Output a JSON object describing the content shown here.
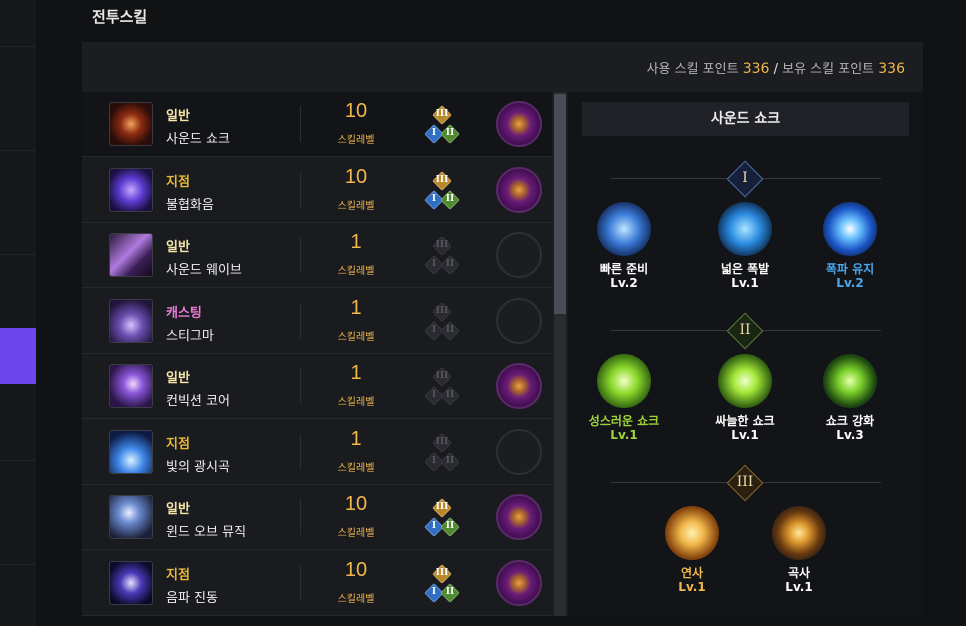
{
  "page": {
    "title": "전투스킬"
  },
  "points": {
    "used_label": "사용 스킬 포인트",
    "used_value": "336",
    "separator": "/",
    "owned_label": "보유 스킬 포인트",
    "owned_value": "336"
  },
  "skills": [
    {
      "type": "일반",
      "type_color": "#f5e6a8",
      "name": "사운드 쇼크",
      "level": "10",
      "level_label": "스킬레벨",
      "tripod_active": true,
      "rune": "purple"
    },
    {
      "type": "지점",
      "type_color": "#e9b931",
      "name": "불협화음",
      "level": "10",
      "level_label": "스킬레벨",
      "tripod_active": true,
      "rune": "purple"
    },
    {
      "type": "일반",
      "type_color": "#f5e6a8",
      "name": "사운드 웨이브",
      "level": "1",
      "level_label": "스킬레벨",
      "tripod_active": false,
      "rune": "empty"
    },
    {
      "type": "캐스팅",
      "type_color": "#e97bd7",
      "name": "스티그마",
      "level": "1",
      "level_label": "스킬레벨",
      "tripod_active": false,
      "rune": "empty"
    },
    {
      "type": "일반",
      "type_color": "#f5e6a8",
      "name": "컨빅션 코어",
      "level": "1",
      "level_label": "스킬레벨",
      "tripod_active": false,
      "rune": "purple"
    },
    {
      "type": "지점",
      "type_color": "#e9b931",
      "name": "빛의 광시곡",
      "level": "1",
      "level_label": "스킬레벨",
      "tripod_active": false,
      "rune": "empty"
    },
    {
      "type": "일반",
      "type_color": "#f5e6a8",
      "name": "윈드 오브 뮤직",
      "level": "10",
      "level_label": "스킬레벨",
      "tripod_active": true,
      "rune": "purple"
    },
    {
      "type": "지점",
      "type_color": "#e9b931",
      "name": "음파 진동",
      "level": "10",
      "level_label": "스킬레벨",
      "tripod_active": true,
      "rune": "purple"
    }
  ],
  "tripod_roman": {
    "top": "III",
    "left": "I",
    "right": "II"
  },
  "detail": {
    "title": "사운드 쇼크",
    "tiers": [
      {
        "label": "I",
        "options": [
          {
            "name": "빠른 준비",
            "level": "Lv.2",
            "color": "#ffffff",
            "icon": "hourglass-icon"
          },
          {
            "name": "넓은 폭발",
            "level": "Lv.1",
            "color": "#ffffff",
            "icon": "expand-arrows-icon"
          },
          {
            "name": "폭파 유지",
            "level": "Lv.2",
            "color": "#4aa8f0",
            "icon": "blue-burst-icon"
          }
        ]
      },
      {
        "label": "II",
        "options": [
          {
            "name": "성스러운 쇼크",
            "level": "Lv.1",
            "color": "#9ed43a",
            "icon": "holy-sun-icon"
          },
          {
            "name": "싸늘한 쇼크",
            "level": "Lv.1",
            "color": "#ffffff",
            "icon": "snowflake-icon"
          },
          {
            "name": "쇼크 강화",
            "level": "Lv.3",
            "color": "#ffffff",
            "icon": "staff-sparkle-icon"
          }
        ]
      },
      {
        "label": "III",
        "options": [
          {
            "name": "연사",
            "level": "Lv.1",
            "color": "#f2b84b",
            "icon": "rapid-fire-icon"
          },
          {
            "name": "곡사",
            "level": "Lv.1",
            "color": "#ffffff",
            "icon": "arc-missile-icon"
          }
        ]
      }
    ]
  }
}
